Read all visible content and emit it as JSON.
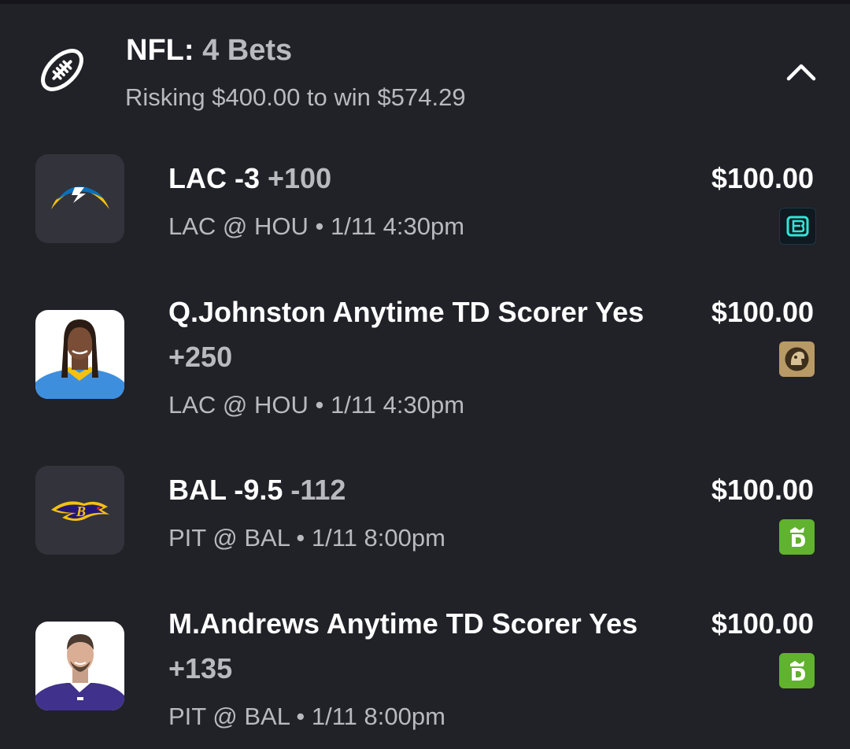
{
  "header": {
    "league": "NFL:",
    "bet_count": "4 Bets",
    "summary": "Risking $400.00 to win $574.29",
    "league_icon": "football-icon",
    "collapse_icon": "chevron-up-icon"
  },
  "bets": [
    {
      "selection": "LAC -3",
      "odds": "+100",
      "matchup": "LAC @ HOU • 1/11 4:30pm",
      "stake": "$100.00",
      "thumb": "chargers-logo",
      "sportsbook": "espn-bet-logo"
    },
    {
      "selection": "Q.Johnston Anytime TD Scorer Yes",
      "odds": "+250",
      "matchup": "LAC @ HOU • 1/11 4:30pm",
      "stake": "$100.00",
      "thumb": "player-photo",
      "sportsbook": "caesars-logo"
    },
    {
      "selection": "BAL -9.5",
      "odds": "-112",
      "matchup": "PIT @ BAL • 1/11 8:00pm",
      "stake": "$100.00",
      "thumb": "ravens-logo",
      "sportsbook": "draftkings-logo"
    },
    {
      "selection": "M.Andrews Anytime TD Scorer Yes",
      "odds": "+135",
      "matchup": "PIT @ BAL • 1/11 8:00pm",
      "stake": "$100.00",
      "thumb": "player-photo",
      "sportsbook": "draftkings-logo"
    }
  ],
  "colors": {
    "background": "#212128",
    "text_primary": "#ffffff",
    "text_secondary": "#b9b9c0",
    "tile": "#33333b",
    "draftkings_green": "#61b22f",
    "caesars_gold": "#b89a66",
    "espn_bet_teal": "#2ee6d6"
  }
}
